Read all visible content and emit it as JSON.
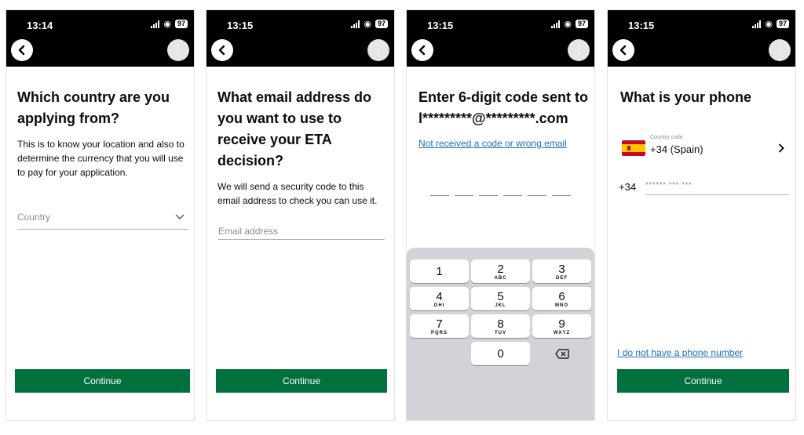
{
  "screens": [
    {
      "time": "13:14",
      "battery": "97",
      "title": "Which country are you applying from?",
      "body": "This is to know your location and also to determine the currency that you will use to pay for your application.",
      "country_placeholder": "Country",
      "continue_label": "Continue"
    },
    {
      "time": "13:15",
      "battery": "97",
      "title": "What email address do you want to use to receive your ETA decision?",
      "body": "We will send a security code to this email address to check you can use it.",
      "email_placeholder": "Email address",
      "continue_label": "Continue"
    },
    {
      "time": "13:15",
      "battery": "97",
      "title_line1": "Enter 6-digit code sent to",
      "title_line2": "l*********@*********.com",
      "link": "Not received a code or wrong email",
      "keypad": {
        "k1": "1",
        "k2": "2",
        "k2_letters": "ABC",
        "k3": "3",
        "k3_letters": "DEF",
        "k4": "4",
        "k4_letters": "GHI",
        "k5": "5",
        "k5_letters": "JKL",
        "k6": "6",
        "k6_letters": "MNO",
        "k7": "7",
        "k7_letters": "PQRS",
        "k8": "8",
        "k8_letters": "TUV",
        "k9": "9",
        "k9_letters": "WXYZ",
        "k0": "0"
      }
    },
    {
      "time": "13:15",
      "battery": "97",
      "title": "What is your phone",
      "country_code_label": "Country code",
      "country_code_value": "+34 (Spain)",
      "prefix": "+34",
      "phone_placeholder": "****** *** ***",
      "no_phone_link": "I do not have a phone number",
      "continue_label": "Continue"
    }
  ],
  "colors": {
    "accent_green": "#00703c",
    "link_blue": "#1d70b8"
  }
}
